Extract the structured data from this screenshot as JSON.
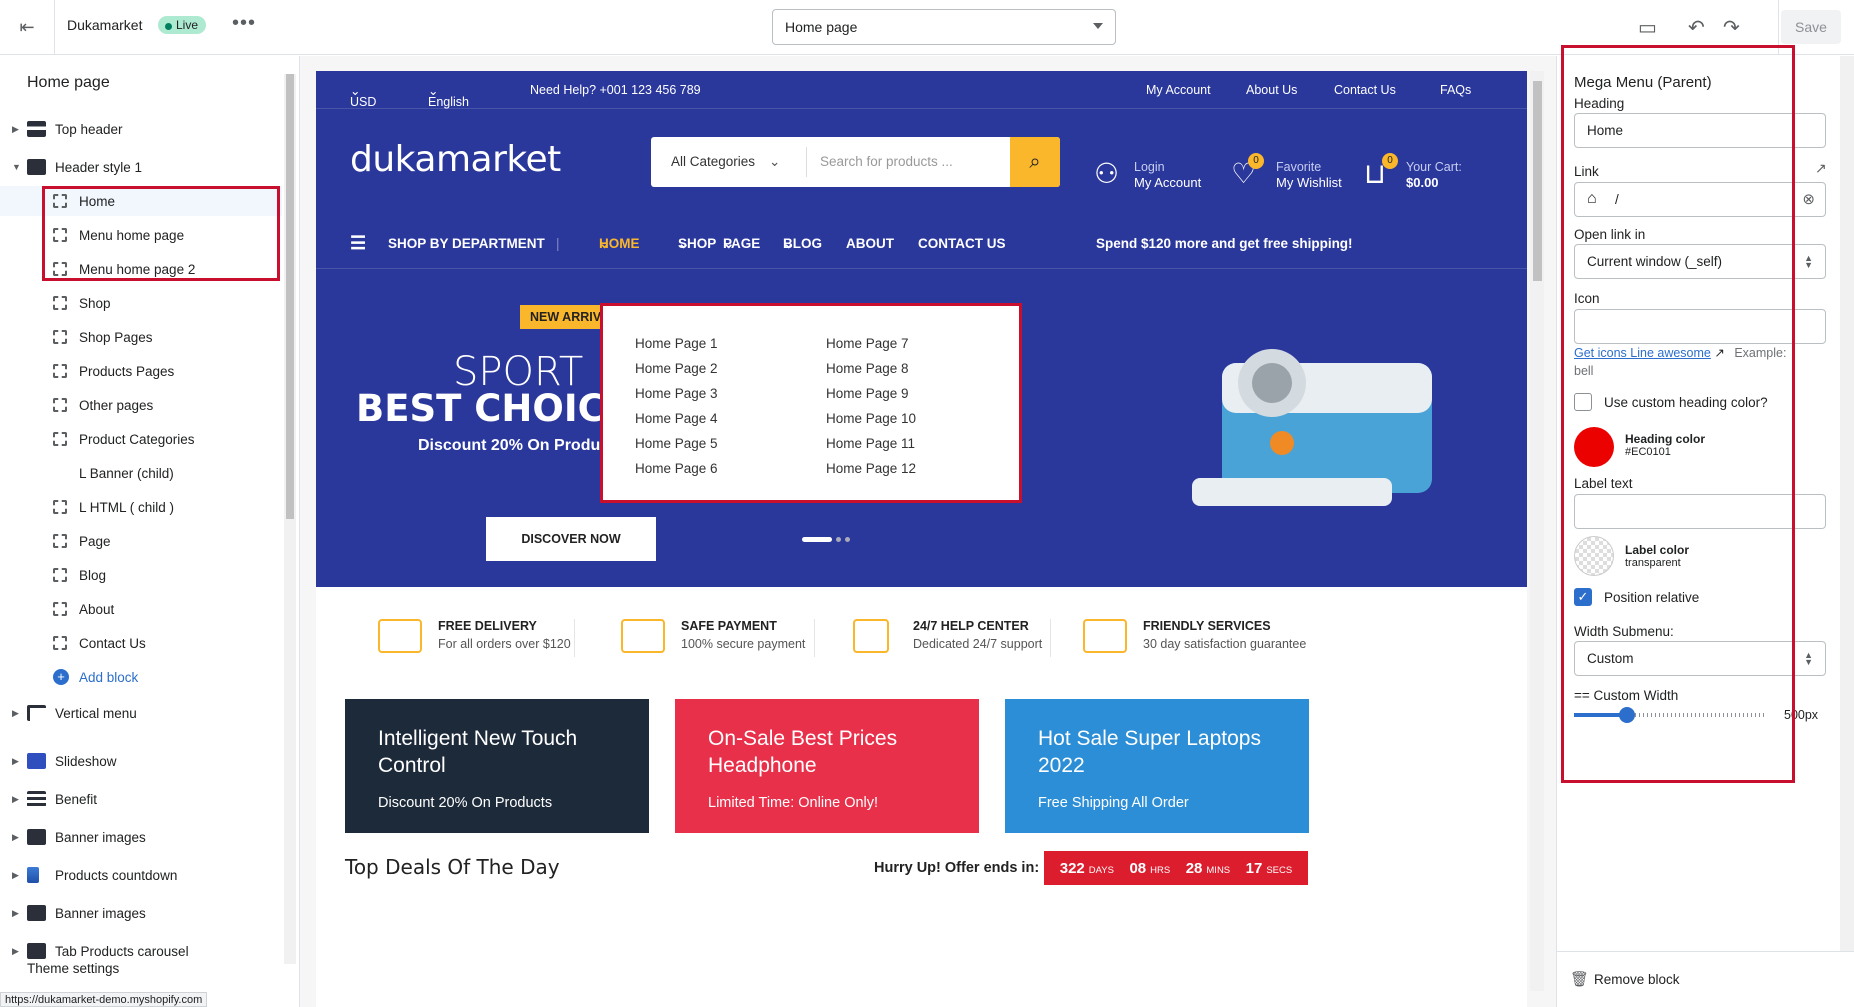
{
  "topbar": {
    "store": "Dukamarket",
    "status": "Live",
    "page_select": "Home page",
    "save": "Save"
  },
  "sidebar": {
    "title": "Home page",
    "items": [
      {
        "label": "Top header"
      },
      {
        "label": "Header style 1"
      },
      {
        "label": "Home"
      },
      {
        "label": "Menu home page"
      },
      {
        "label": "Menu home page 2"
      },
      {
        "label": "Shop"
      },
      {
        "label": "Shop Pages"
      },
      {
        "label": "Products Pages"
      },
      {
        "label": "Other pages"
      },
      {
        "label": "Product Categories"
      },
      {
        "label": "L Banner (child)"
      },
      {
        "label": "L HTML ( child )"
      },
      {
        "label": "Page"
      },
      {
        "label": "Blog"
      },
      {
        "label": "About"
      },
      {
        "label": "Contact Us"
      },
      {
        "label": "Add block"
      },
      {
        "label": "Vertical menu"
      },
      {
        "label": "Slideshow"
      },
      {
        "label": "Benefit"
      },
      {
        "label": "Banner images"
      },
      {
        "label": "Products countdown"
      },
      {
        "label": "Banner images"
      },
      {
        "label": "Tab Products carousel"
      }
    ],
    "theme_settings": "Theme settings",
    "url": "https://dukamarket-demo.myshopify.com"
  },
  "site": {
    "topbar": {
      "currency": "USD",
      "language": "English",
      "help": "Need Help? +001 123 456 789",
      "links": [
        "My Account",
        "About Us",
        "Contact Us",
        "FAQs"
      ]
    },
    "logo": "dukamarket",
    "search": {
      "category": "All Categories",
      "placeholder": "Search for products ..."
    },
    "login": {
      "top": "Login",
      "bottom": "My Account"
    },
    "favorite": {
      "top": "Favorite",
      "bottom": "My Wishlist",
      "count": "0"
    },
    "cart": {
      "top": "Your Cart:",
      "bottom": "$0.00",
      "count": "0"
    },
    "nav": {
      "department": "SHOP BY DEPARTMENT",
      "items": [
        "HOME",
        "SHOP",
        "PAGE",
        "BLOG",
        "ABOUT",
        "CONTACT US"
      ],
      "promo": "Spend $120 more and get free shipping!"
    },
    "hero": {
      "badge": "NEW ARRIVA",
      "line1": "SPORT ED",
      "line2": "BEST CHOICE O",
      "line3": "Discount 20% On Product",
      "button": "DISCOVER NOW"
    },
    "mega": [
      "Home Page 1",
      "Home Page 2",
      "Home Page 3",
      "Home Page 4",
      "Home Page 5",
      "Home Page 6",
      "Home Page 7",
      "Home Page 8",
      "Home Page 9",
      "Home Page 10",
      "Home Page 11",
      "Home Page 12"
    ],
    "features": [
      {
        "title": "FREE DELIVERY",
        "text": "For all orders over $120"
      },
      {
        "title": "SAFE PAYMENT",
        "text": "100% secure payment"
      },
      {
        "title": "24/7 HELP CENTER",
        "text": "Dedicated 24/7 support"
      },
      {
        "title": "FRIENDLY SERVICES",
        "text": "30 day satisfaction guarantee"
      }
    ],
    "banners": [
      {
        "title": "Intelligent New Touch Control",
        "sub": "Discount 20% On Products",
        "color": "#1c2a3a"
      },
      {
        "title": "On-Sale Best Prices Headphone",
        "sub": "Limited Time: Online Only!",
        "color": "#e8304a"
      },
      {
        "title": "Hot Sale Super Laptops 2022",
        "sub": "Free Shipping All Order",
        "color": "#2b8ed6"
      }
    ],
    "deals": "Top Deals Of The Day",
    "hurry": "Hurry Up! Offer ends in:",
    "timer": [
      {
        "v": "322",
        "u": "DAYS"
      },
      {
        "v": "08",
        "u": "HRS"
      },
      {
        "v": "28",
        "u": "MINS"
      },
      {
        "v": "17",
        "u": "SECS"
      }
    ]
  },
  "panel": {
    "title": "Mega Menu (Parent)",
    "heading_label": "Heading",
    "heading_value": "Home",
    "link_label": "Link",
    "link_value": "/",
    "open_label": "Open link in",
    "open_value": "Current window (_self)",
    "icon_label": "Icon",
    "icons_link": "Get icons Line awesome",
    "icons_example": "Example:",
    "icons_example_value": "bell",
    "custom_heading": "Use custom heading color?",
    "heading_color_label": "Heading color",
    "heading_color": "#EC0101",
    "label_text": "Label text",
    "label_color_label": "Label color",
    "label_color": "transparent",
    "position_relative": "Position relative",
    "width_label": "Width Submenu:",
    "width_value": "Custom",
    "custom_width": "== Custom Width",
    "custom_width_value": "500px",
    "slider_fraction": 0.25,
    "remove": "Remove block"
  }
}
